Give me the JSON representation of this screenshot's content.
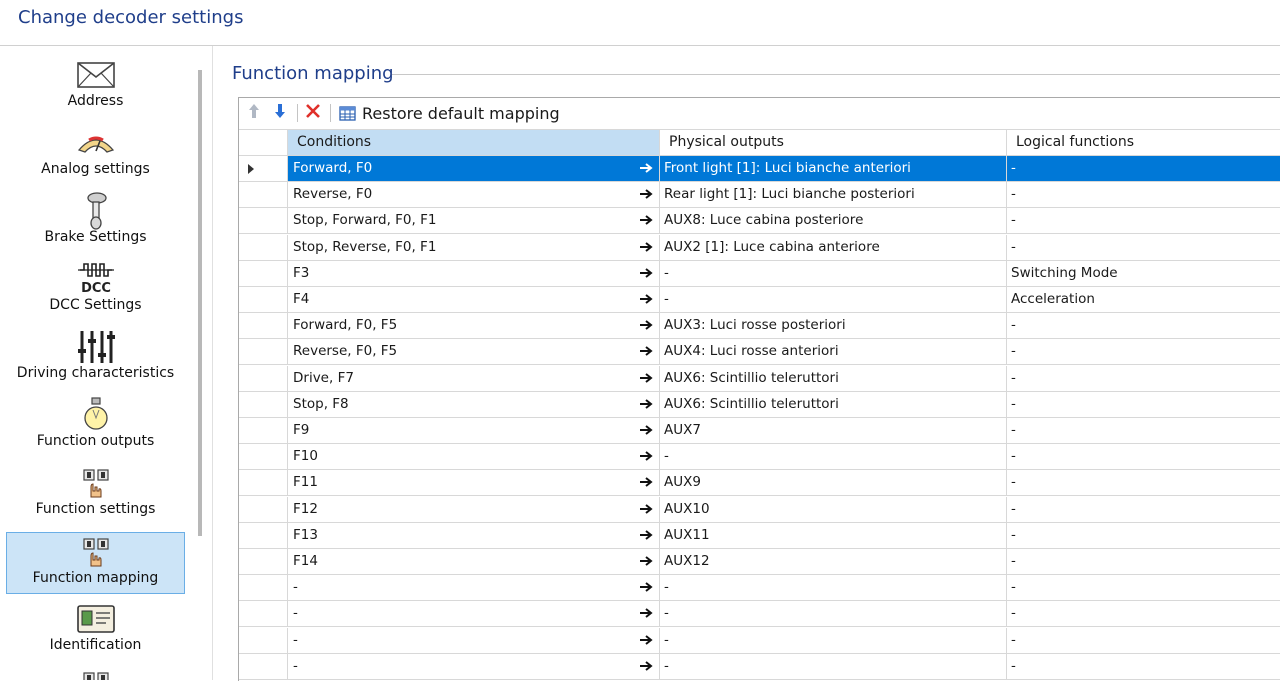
{
  "window": {
    "title": "Change decoder settings"
  },
  "sidebar": {
    "items": [
      {
        "label": "Address",
        "icon": "envelope-icon",
        "selected": false
      },
      {
        "label": "Analog settings",
        "icon": "gauge-icon",
        "selected": false
      },
      {
        "label": "Brake Settings",
        "icon": "brake-lever-icon",
        "selected": false
      },
      {
        "label": "DCC Settings",
        "icon": "dcc-icon",
        "selected": false
      },
      {
        "label": "Driving characteristics",
        "icon": "sliders-icon",
        "selected": false
      },
      {
        "label": "Function outputs",
        "icon": "lightbulb-icon",
        "selected": false
      },
      {
        "label": "Function settings",
        "icon": "hand-switches-icon",
        "selected": false
      },
      {
        "label": "Function mapping",
        "icon": "hand-switches-icon",
        "selected": true
      },
      {
        "label": "Identification",
        "icon": "id-card-icon",
        "selected": false
      }
    ]
  },
  "main": {
    "section_title": "Function mapping",
    "toolbar": {
      "move_up": "up-arrow-icon",
      "move_down": "down-arrow-icon",
      "delete": "red-x-icon",
      "restore_label": "Restore default mapping"
    },
    "table": {
      "columns": [
        "Conditions",
        "Physical outputs",
        "Logical functions"
      ],
      "rows": [
        {
          "condition": "Forward, F0",
          "physical": "Front light [1]: Luci bianche anteriori",
          "logical": "-",
          "selected": true
        },
        {
          "condition": "Reverse, F0",
          "physical": "Rear light [1]: Luci bianche posteriori",
          "logical": "-"
        },
        {
          "condition": "Stop, Forward, F0, F1",
          "physical": "AUX8: Luce cabina posteriore",
          "logical": "-"
        },
        {
          "condition": "Stop, Reverse, F0, F1",
          "physical": "AUX2 [1]: Luce cabina anteriore",
          "logical": "-"
        },
        {
          "condition": "F3",
          "physical": "-",
          "logical": "Switching Mode"
        },
        {
          "condition": "F4",
          "physical": "-",
          "logical": "Acceleration"
        },
        {
          "condition": "Forward, F0, F5",
          "physical": "AUX3: Luci rosse posteriori",
          "logical": "-"
        },
        {
          "condition": "Reverse, F0, F5",
          "physical": "AUX4: Luci rosse anteriori",
          "logical": "-"
        },
        {
          "condition": "Drive, F7",
          "physical": "AUX6: Scintillio teleruttori",
          "logical": "-"
        },
        {
          "condition": "Stop, F8",
          "physical": "AUX6: Scintillio teleruttori",
          "logical": "-"
        },
        {
          "condition": "F9",
          "physical": "AUX7",
          "logical": "-"
        },
        {
          "condition": "F10",
          "physical": "-",
          "logical": "-"
        },
        {
          "condition": "F11",
          "physical": "AUX9",
          "logical": "-"
        },
        {
          "condition": "F12",
          "physical": "AUX10",
          "logical": "-"
        },
        {
          "condition": "F13",
          "physical": "AUX11",
          "logical": "-"
        },
        {
          "condition": "F14",
          "physical": "AUX12",
          "logical": "-"
        },
        {
          "condition": "-",
          "physical": "-",
          "logical": "-"
        },
        {
          "condition": "-",
          "physical": "-",
          "logical": "-"
        },
        {
          "condition": "-",
          "physical": "-",
          "logical": "-"
        },
        {
          "condition": "-",
          "physical": "-",
          "logical": "-"
        }
      ]
    }
  }
}
